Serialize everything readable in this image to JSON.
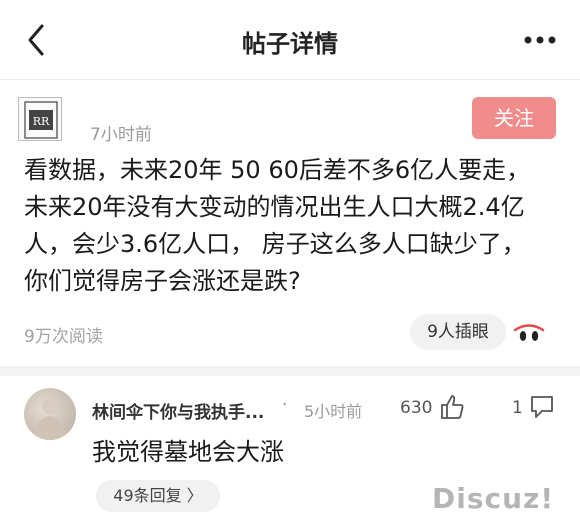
{
  "header": {
    "title": "帖子详情"
  },
  "post": {
    "author_logo_text": "RR",
    "time": "7小时前",
    "follow_label": "关注",
    "lines": [
      "看数据，未来20年  50  60后差不多6亿人要走，",
      "未来20年没有大变动的情况出生人口大概2.4亿",
      "人，会少3.6亿人口，    房子这么多人口缺少了，",
      "你们觉得房子会涨还是跌?"
    ],
    "views": "9万次阅读",
    "readers": "9人插眼"
  },
  "comment": {
    "user": "林间伞下你与我执手...",
    "dot": "·",
    "time": "5小时前",
    "likes": "630",
    "replies": "1",
    "text": "我觉得墓地会大涨",
    "replies_link": "49条回复 〉"
  },
  "watermark": "Discuz!",
  "colors": {
    "follow_bg": "#f08c8c",
    "divider": "#f4f4f4"
  }
}
